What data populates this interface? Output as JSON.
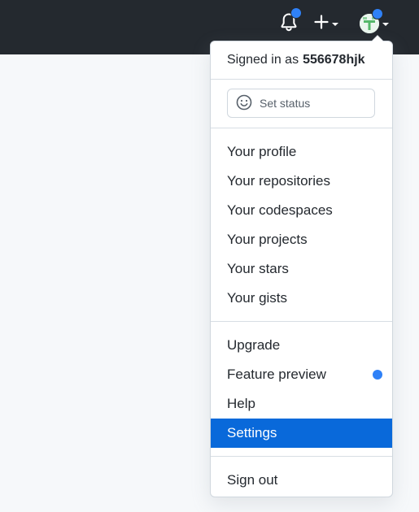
{
  "header": {
    "notifications_icon": "bell-icon",
    "create_icon": "plus-icon",
    "avatar_icon": "avatar-icon",
    "dot_color": "#2f81f7"
  },
  "dropdown": {
    "signed_in_prefix": "Signed in as",
    "username": "556678hjk",
    "set_status_label": "Set status",
    "groups": [
      [
        "Your profile",
        "Your repositories",
        "Your codespaces",
        "Your projects",
        "Your stars",
        "Your gists"
      ],
      [
        "Upgrade",
        "Feature preview",
        "Help",
        "Settings"
      ],
      [
        "Sign out"
      ]
    ],
    "active_item": "Settings",
    "accent_color": "#0969da"
  }
}
